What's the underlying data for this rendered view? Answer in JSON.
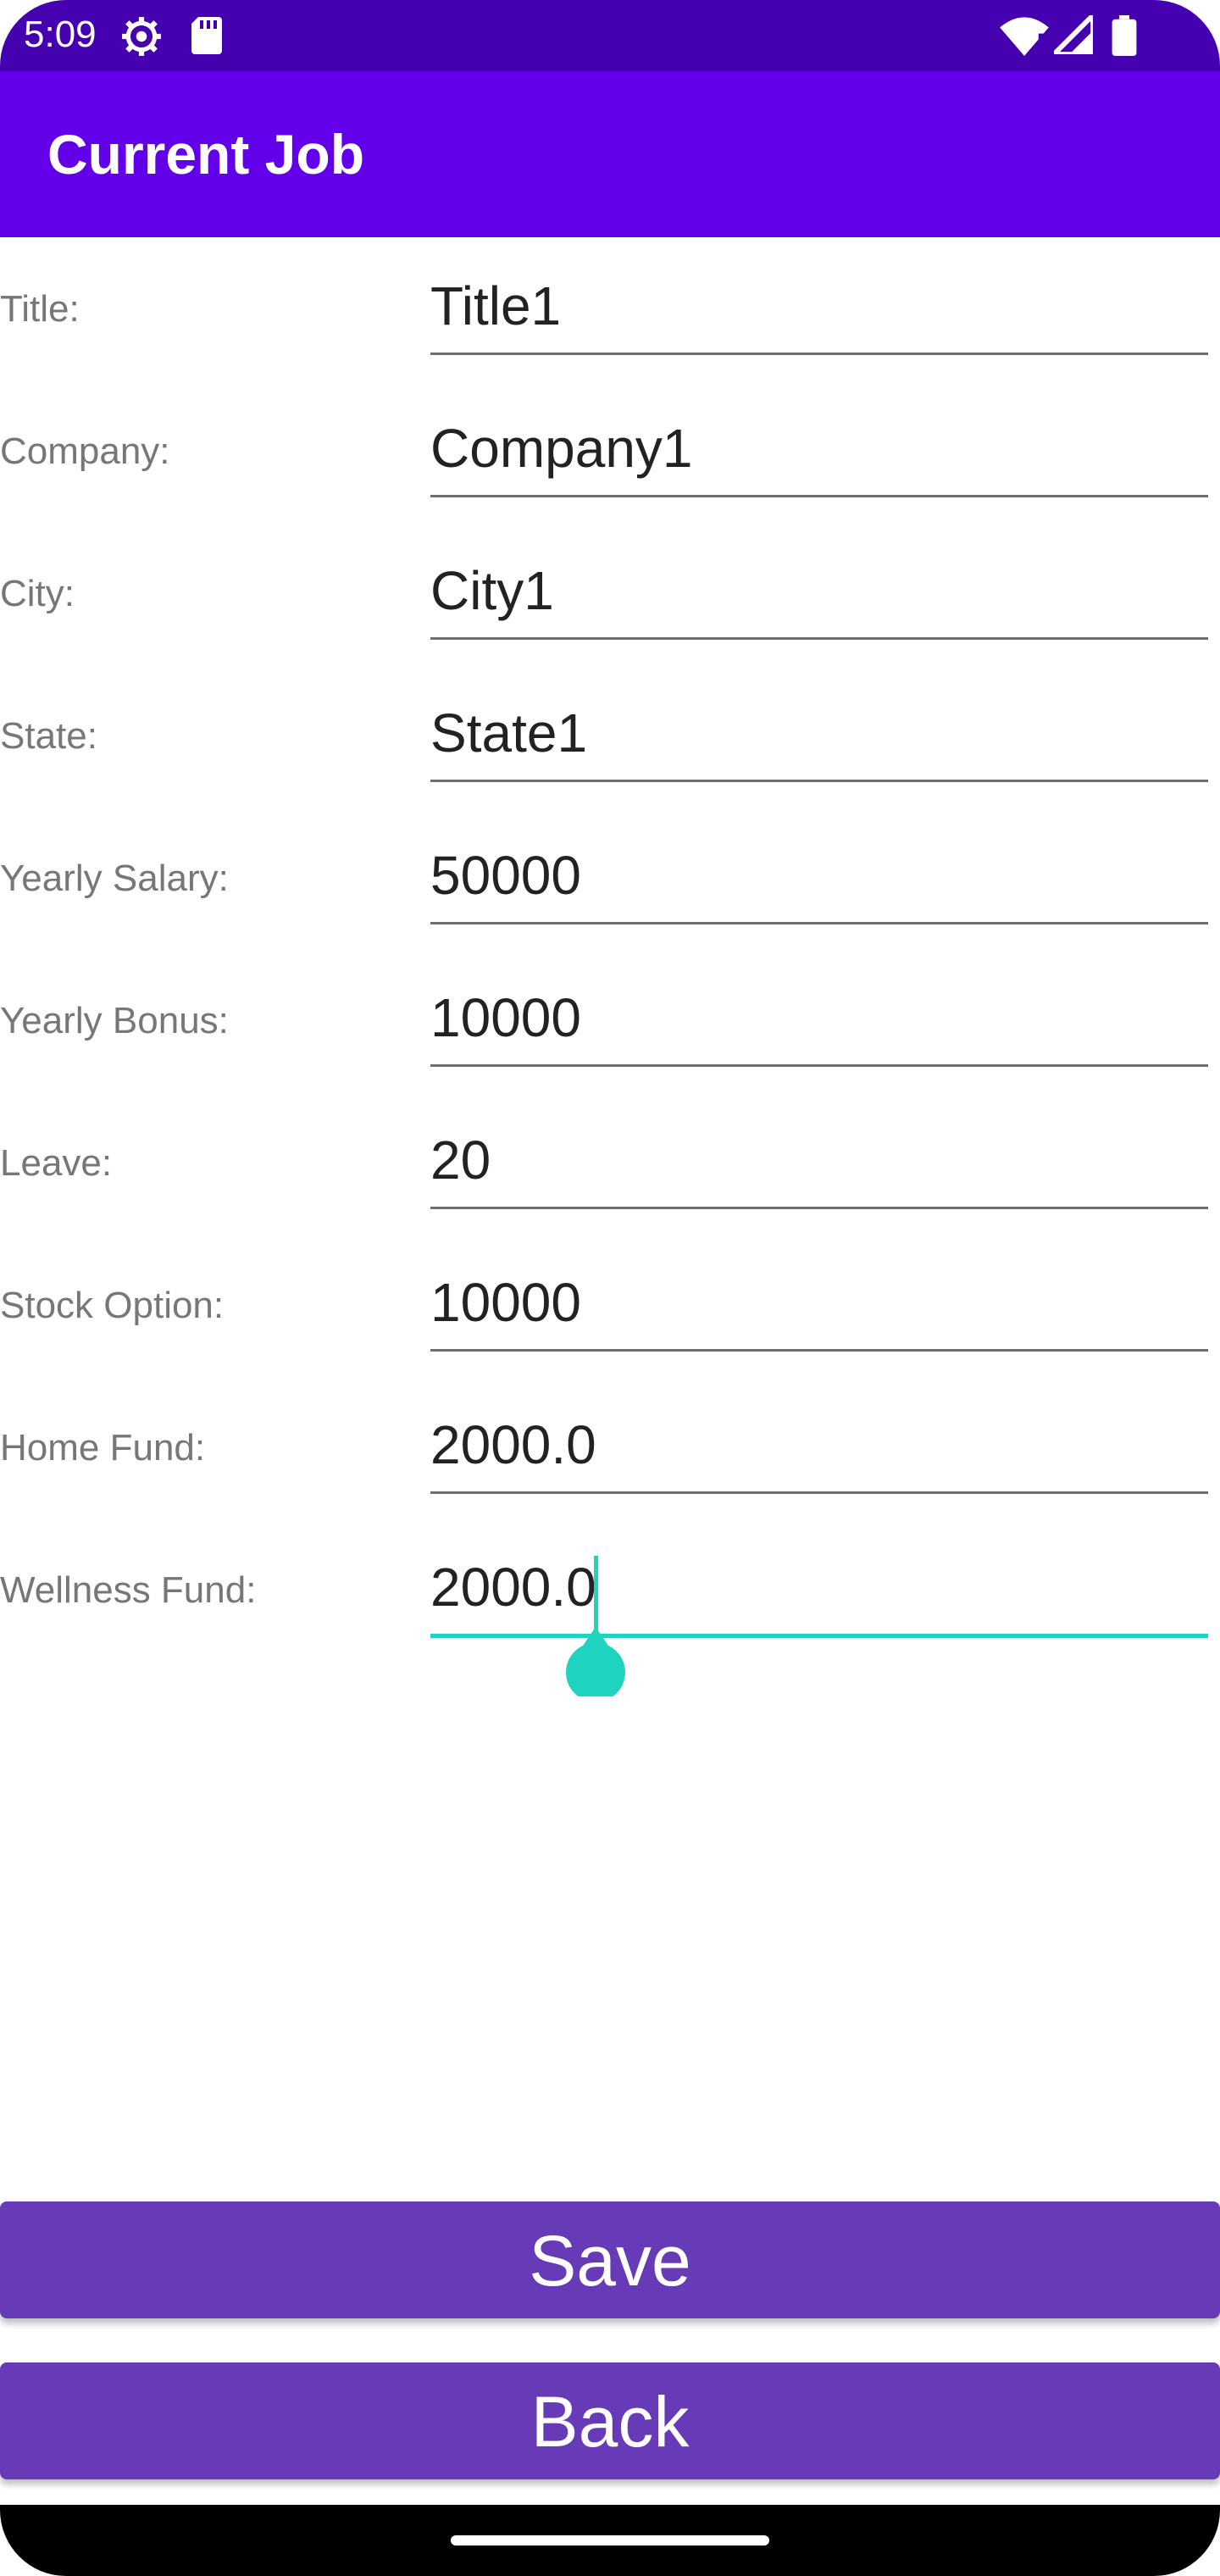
{
  "status_bar": {
    "time": "5:09",
    "icons": [
      "settings-icon",
      "sd-card-icon",
      "wifi-icon",
      "signal-icon",
      "battery-icon"
    ]
  },
  "app_bar": {
    "title": "Current Job"
  },
  "form": {
    "fields": [
      {
        "label": "Title:",
        "value": "Title1"
      },
      {
        "label": "Company:",
        "value": "Company1"
      },
      {
        "label": "City:",
        "value": "City1"
      },
      {
        "label": "State:",
        "value": "State1"
      },
      {
        "label": "Yearly Salary:",
        "value": "50000"
      },
      {
        "label": "Yearly Bonus:",
        "value": "10000"
      },
      {
        "label": "Leave:",
        "value": "20"
      },
      {
        "label": "Stock Option:",
        "value": "10000"
      },
      {
        "label": "Home Fund:",
        "value": "2000.0"
      },
      {
        "label": "Wellness Fund:",
        "value": "2000.0"
      }
    ]
  },
  "buttons": {
    "save": "Save",
    "back": "Back"
  },
  "colors": {
    "status_bar": "#4500b0",
    "app_bar": "#6200ea",
    "button": "#673ab7",
    "focus_accent": "#1ed3c0"
  }
}
